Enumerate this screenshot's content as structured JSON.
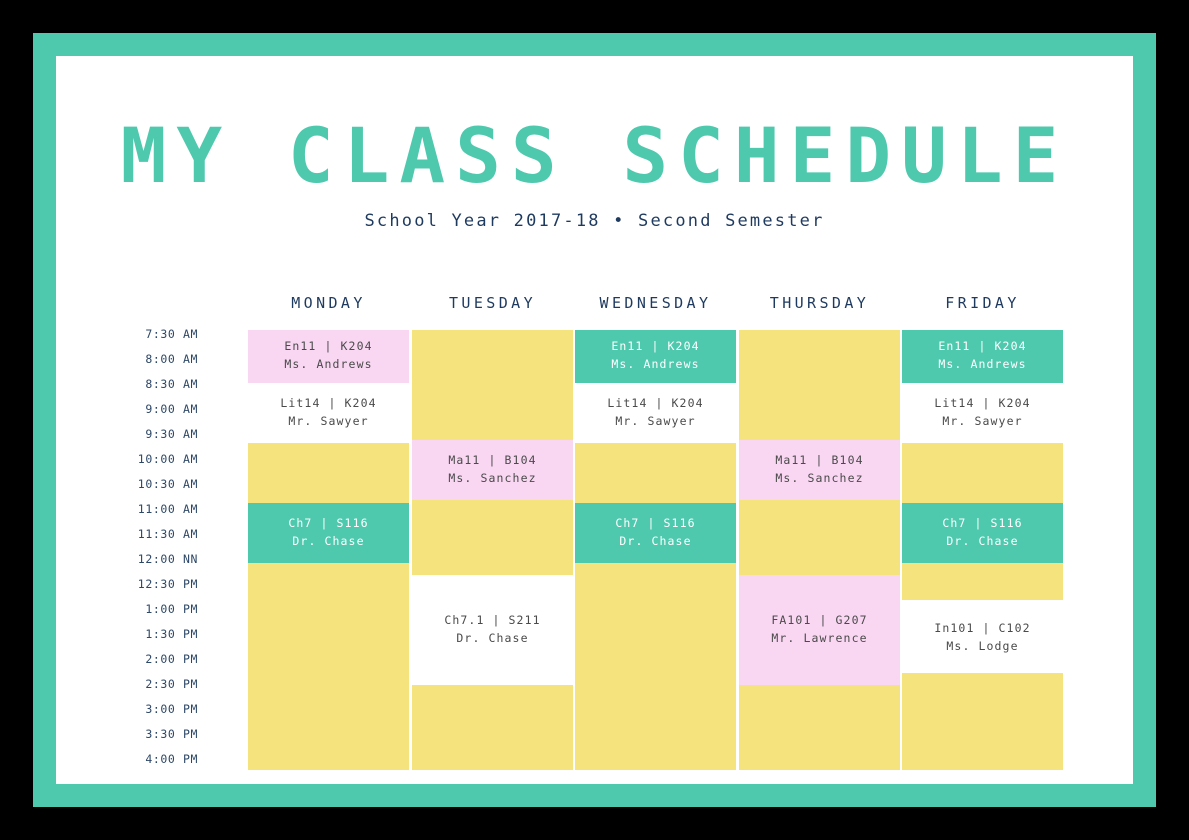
{
  "poster": {
    "title": "MY CLASS SCHEDULE",
    "subtitle": "School Year 2017-18  •  Second Semester"
  },
  "colors": {
    "frame": "#4FC9AE",
    "page": "#FFFFFF",
    "backdrop": "#000000",
    "title": "#4FC9AE",
    "subtitle_text": "#1F3A5F",
    "header_text": "#1F3A5F",
    "time_text": "#2C4767",
    "yellow": "#F5E47E",
    "pink": "#F9D7F3",
    "teal": "#4FC9AE",
    "white": "#FFFFFF",
    "block_text_dark": "#4A4A4A",
    "block_text_light": "#FFFFFF"
  },
  "grid": {
    "day_headers": [
      "MONDAY",
      "TUESDAY",
      "WEDNESDAY",
      "THURSDAY",
      "FRIDAY"
    ],
    "time_labels": [
      "7:30 AM",
      "8:00 AM",
      "8:30 AM",
      "9:00 AM",
      "9:30 AM",
      "10:00 AM",
      "10:30 AM",
      "11:00 AM",
      "11:30 AM",
      "12:00 NN",
      "12:30 PM",
      "1:00 PM",
      "1:30 PM",
      "2:00 PM",
      "2:30 PM",
      "3:00 PM",
      "3:30 PM",
      "4:00 PM"
    ],
    "start_time": "7:30 AM",
    "end_time": "4:00 PM",
    "slot_minutes": 30
  },
  "days": [
    {
      "name": "MONDAY",
      "blocks": [
        {
          "code": "En11 | K204",
          "teacher": "Ms. Andrews",
          "color": "pink",
          "text": "dark",
          "start": 0.0,
          "span": 2.1
        },
        {
          "code": "Lit14 | K204",
          "teacher": "Mr. Sawyer",
          "color": "white",
          "text": "dark",
          "start": 2.1,
          "span": 2.4
        },
        {
          "code": "",
          "teacher": "",
          "color": "yellow",
          "text": "dark",
          "start": 4.5,
          "span": 2.4
        },
        {
          "code": "Ch7 | S116",
          "teacher": "Dr. Chase",
          "color": "teal",
          "text": "light",
          "start": 6.9,
          "span": 2.4
        },
        {
          "code": "",
          "teacher": "",
          "color": "yellow",
          "text": "dark",
          "start": 9.3,
          "span": 8.3
        }
      ]
    },
    {
      "name": "TUESDAY",
      "blocks": [
        {
          "code": "",
          "teacher": "",
          "color": "yellow",
          "text": "dark",
          "start": 0.0,
          "span": 4.4
        },
        {
          "code": "Ma11 | B104",
          "teacher": "Ms. Sanchez",
          "color": "pink",
          "text": "dark",
          "start": 4.4,
          "span": 2.4
        },
        {
          "code": "",
          "teacher": "",
          "color": "yellow",
          "text": "dark",
          "start": 6.8,
          "span": 3.0
        },
        {
          "code": "Ch7.1 | S211",
          "teacher": "Dr. Chase",
          "color": "white",
          "text": "dark",
          "start": 9.8,
          "span": 4.4
        },
        {
          "code": "",
          "teacher": "",
          "color": "yellow",
          "text": "dark",
          "start": 14.2,
          "span": 3.4
        }
      ]
    },
    {
      "name": "WEDNESDAY",
      "blocks": [
        {
          "code": "En11 | K204",
          "teacher": "Ms. Andrews",
          "color": "teal",
          "text": "light",
          "start": 0.0,
          "span": 2.1
        },
        {
          "code": "Lit14 | K204",
          "teacher": "Mr. Sawyer",
          "color": "white",
          "text": "dark",
          "start": 2.1,
          "span": 2.4
        },
        {
          "code": "",
          "teacher": "",
          "color": "yellow",
          "text": "dark",
          "start": 4.5,
          "span": 2.4
        },
        {
          "code": "Ch7 | S116",
          "teacher": "Dr. Chase",
          "color": "teal",
          "text": "light",
          "start": 6.9,
          "span": 2.4
        },
        {
          "code": "",
          "teacher": "",
          "color": "yellow",
          "text": "dark",
          "start": 9.3,
          "span": 8.3
        }
      ]
    },
    {
      "name": "THURSDAY",
      "blocks": [
        {
          "code": "",
          "teacher": "",
          "color": "yellow",
          "text": "dark",
          "start": 0.0,
          "span": 4.4
        },
        {
          "code": "Ma11 | B104",
          "teacher": "Ms. Sanchez",
          "color": "pink",
          "text": "dark",
          "start": 4.4,
          "span": 2.4
        },
        {
          "code": "",
          "teacher": "",
          "color": "yellow",
          "text": "dark",
          "start": 6.8,
          "span": 3.0
        },
        {
          "code": "FA101 | G207",
          "teacher": "Mr. Lawrence",
          "color": "pink",
          "text": "dark",
          "start": 9.8,
          "span": 4.4
        },
        {
          "code": "",
          "teacher": "",
          "color": "yellow",
          "text": "dark",
          "start": 14.2,
          "span": 3.4
        }
      ]
    },
    {
      "name": "FRIDAY",
      "blocks": [
        {
          "code": "En11 | K204",
          "teacher": "Ms. Andrews",
          "color": "teal",
          "text": "light",
          "start": 0.0,
          "span": 2.1
        },
        {
          "code": "Lit14 | K204",
          "teacher": "Mr. Sawyer",
          "color": "white",
          "text": "dark",
          "start": 2.1,
          "span": 2.4
        },
        {
          "code": "",
          "teacher": "",
          "color": "yellow",
          "text": "dark",
          "start": 4.5,
          "span": 2.4
        },
        {
          "code": "Ch7 | S116",
          "teacher": "Dr. Chase",
          "color": "teal",
          "text": "light",
          "start": 6.9,
          "span": 2.4
        },
        {
          "code": "",
          "teacher": "",
          "color": "yellow",
          "text": "dark",
          "start": 9.3,
          "span": 1.5
        },
        {
          "code": "In101 | C102",
          "teacher": "Ms. Lodge",
          "color": "white",
          "text": "dark",
          "start": 10.9,
          "span": 2.8
        },
        {
          "code": "",
          "teacher": "",
          "color": "yellow",
          "text": "dark",
          "start": 13.7,
          "span": 3.9
        }
      ]
    }
  ]
}
